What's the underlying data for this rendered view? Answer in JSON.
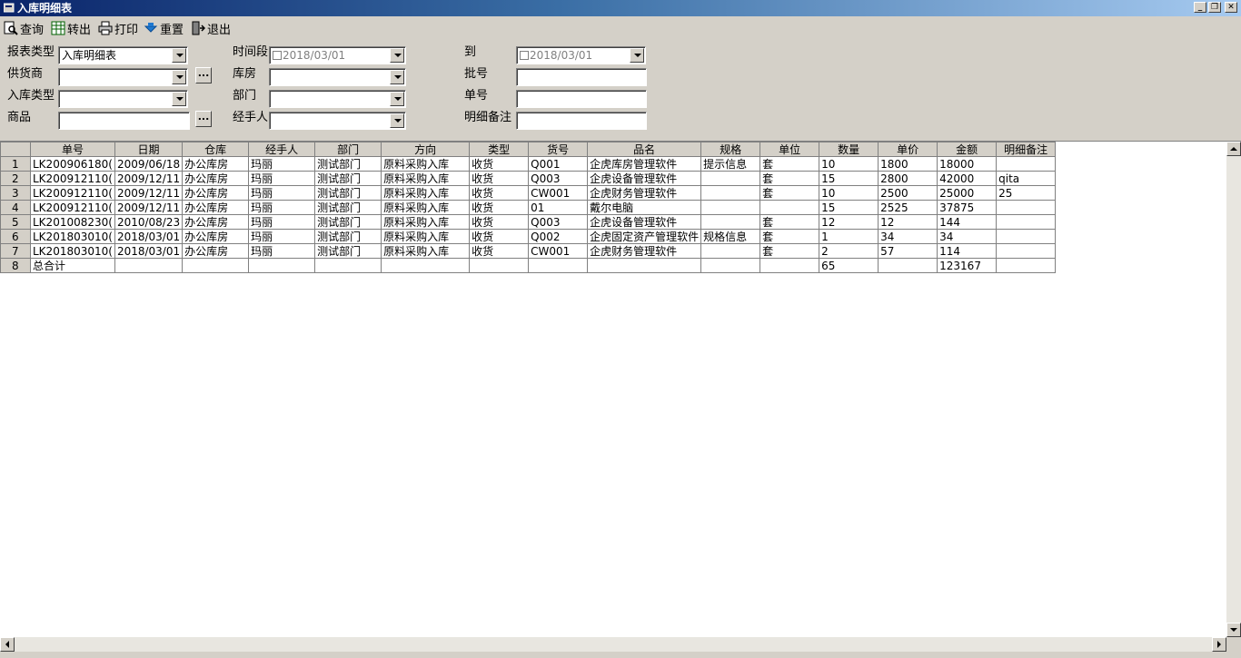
{
  "window": {
    "title": "入库明细表"
  },
  "toolbar": {
    "query": "查询",
    "export": "转出",
    "print": "打印",
    "reset": "重置",
    "exit": "退出"
  },
  "form": {
    "report_type_label": "报表类型",
    "report_type_value": "入库明细表",
    "period_label": "时间段",
    "date_from": "2018/03/01",
    "to_label": "到",
    "date_to": "2018/03/01",
    "supplier_label": "供货商",
    "supplier_value": "",
    "warehouse_label": "库房",
    "warehouse_value": "",
    "batch_label": "批号",
    "batch_value": "",
    "in_type_label": "入库类型",
    "in_type_value": "",
    "dept_label": "部门",
    "dept_value": "",
    "doc_no_label": "单号",
    "doc_no_value": "",
    "product_label": "商品",
    "product_value": "",
    "handler_label": "经手人",
    "handler_value": "",
    "detail_note_label": "明细备注",
    "detail_note_value": "",
    "browse_label": "..."
  },
  "grid": {
    "columns": [
      "单号",
      "日期",
      "仓库",
      "经手人",
      "部门",
      "方向",
      "类型",
      "货号",
      "品名",
      "规格",
      "单位",
      "数量",
      "单价",
      "金额",
      "明细备注"
    ],
    "rows": [
      [
        "1",
        "LK200906180(",
        "2009/06/18",
        "办公库房",
        "玛丽",
        "测试部门",
        "原料采购入库",
        "收货",
        "Q001",
        "企虎库房管理软件",
        "提示信息",
        "套",
        "10",
        "1800",
        "18000",
        ""
      ],
      [
        "2",
        "LK200912110(",
        "2009/12/11",
        "办公库房",
        "玛丽",
        "测试部门",
        "原料采购入库",
        "收货",
        "Q003",
        "企虎设备管理软件",
        "",
        "套",
        "15",
        "2800",
        "42000",
        "qita"
      ],
      [
        "3",
        "LK200912110(",
        "2009/12/11",
        "办公库房",
        "玛丽",
        "测试部门",
        "原料采购入库",
        "收货",
        "CW001",
        "企虎财务管理软件",
        "",
        "套",
        "10",
        "2500",
        "25000",
        "25"
      ],
      [
        "4",
        "LK200912110(",
        "2009/12/11",
        "办公库房",
        "玛丽",
        "测试部门",
        "原料采购入库",
        "收货",
        "01",
        "戴尔电脑",
        "",
        "",
        "15",
        "2525",
        "37875",
        ""
      ],
      [
        "5",
        "LK201008230(",
        "2010/08/23",
        "办公库房",
        "玛丽",
        "测试部门",
        "原料采购入库",
        "收货",
        "Q003",
        "企虎设备管理软件",
        "",
        "套",
        "12",
        "12",
        "144",
        ""
      ],
      [
        "6",
        "LK201803010(",
        "2018/03/01",
        "办公库房",
        "玛丽",
        "测试部门",
        "原料采购入库",
        "收货",
        "Q002",
        "企虎固定资产管理软件",
        "规格信息",
        "套",
        "1",
        "34",
        "34",
        ""
      ],
      [
        "7",
        "LK201803010(",
        "2018/03/01",
        "办公库房",
        "玛丽",
        "测试部门",
        "原料采购入库",
        "收货",
        "CW001",
        "企虎财务管理软件",
        "",
        "套",
        "2",
        "57",
        "114",
        ""
      ],
      [
        "8",
        "总合计",
        "",
        "",
        "",
        "",
        "",
        "",
        "",
        "",
        "",
        "",
        "65",
        "",
        "123167",
        ""
      ]
    ]
  }
}
